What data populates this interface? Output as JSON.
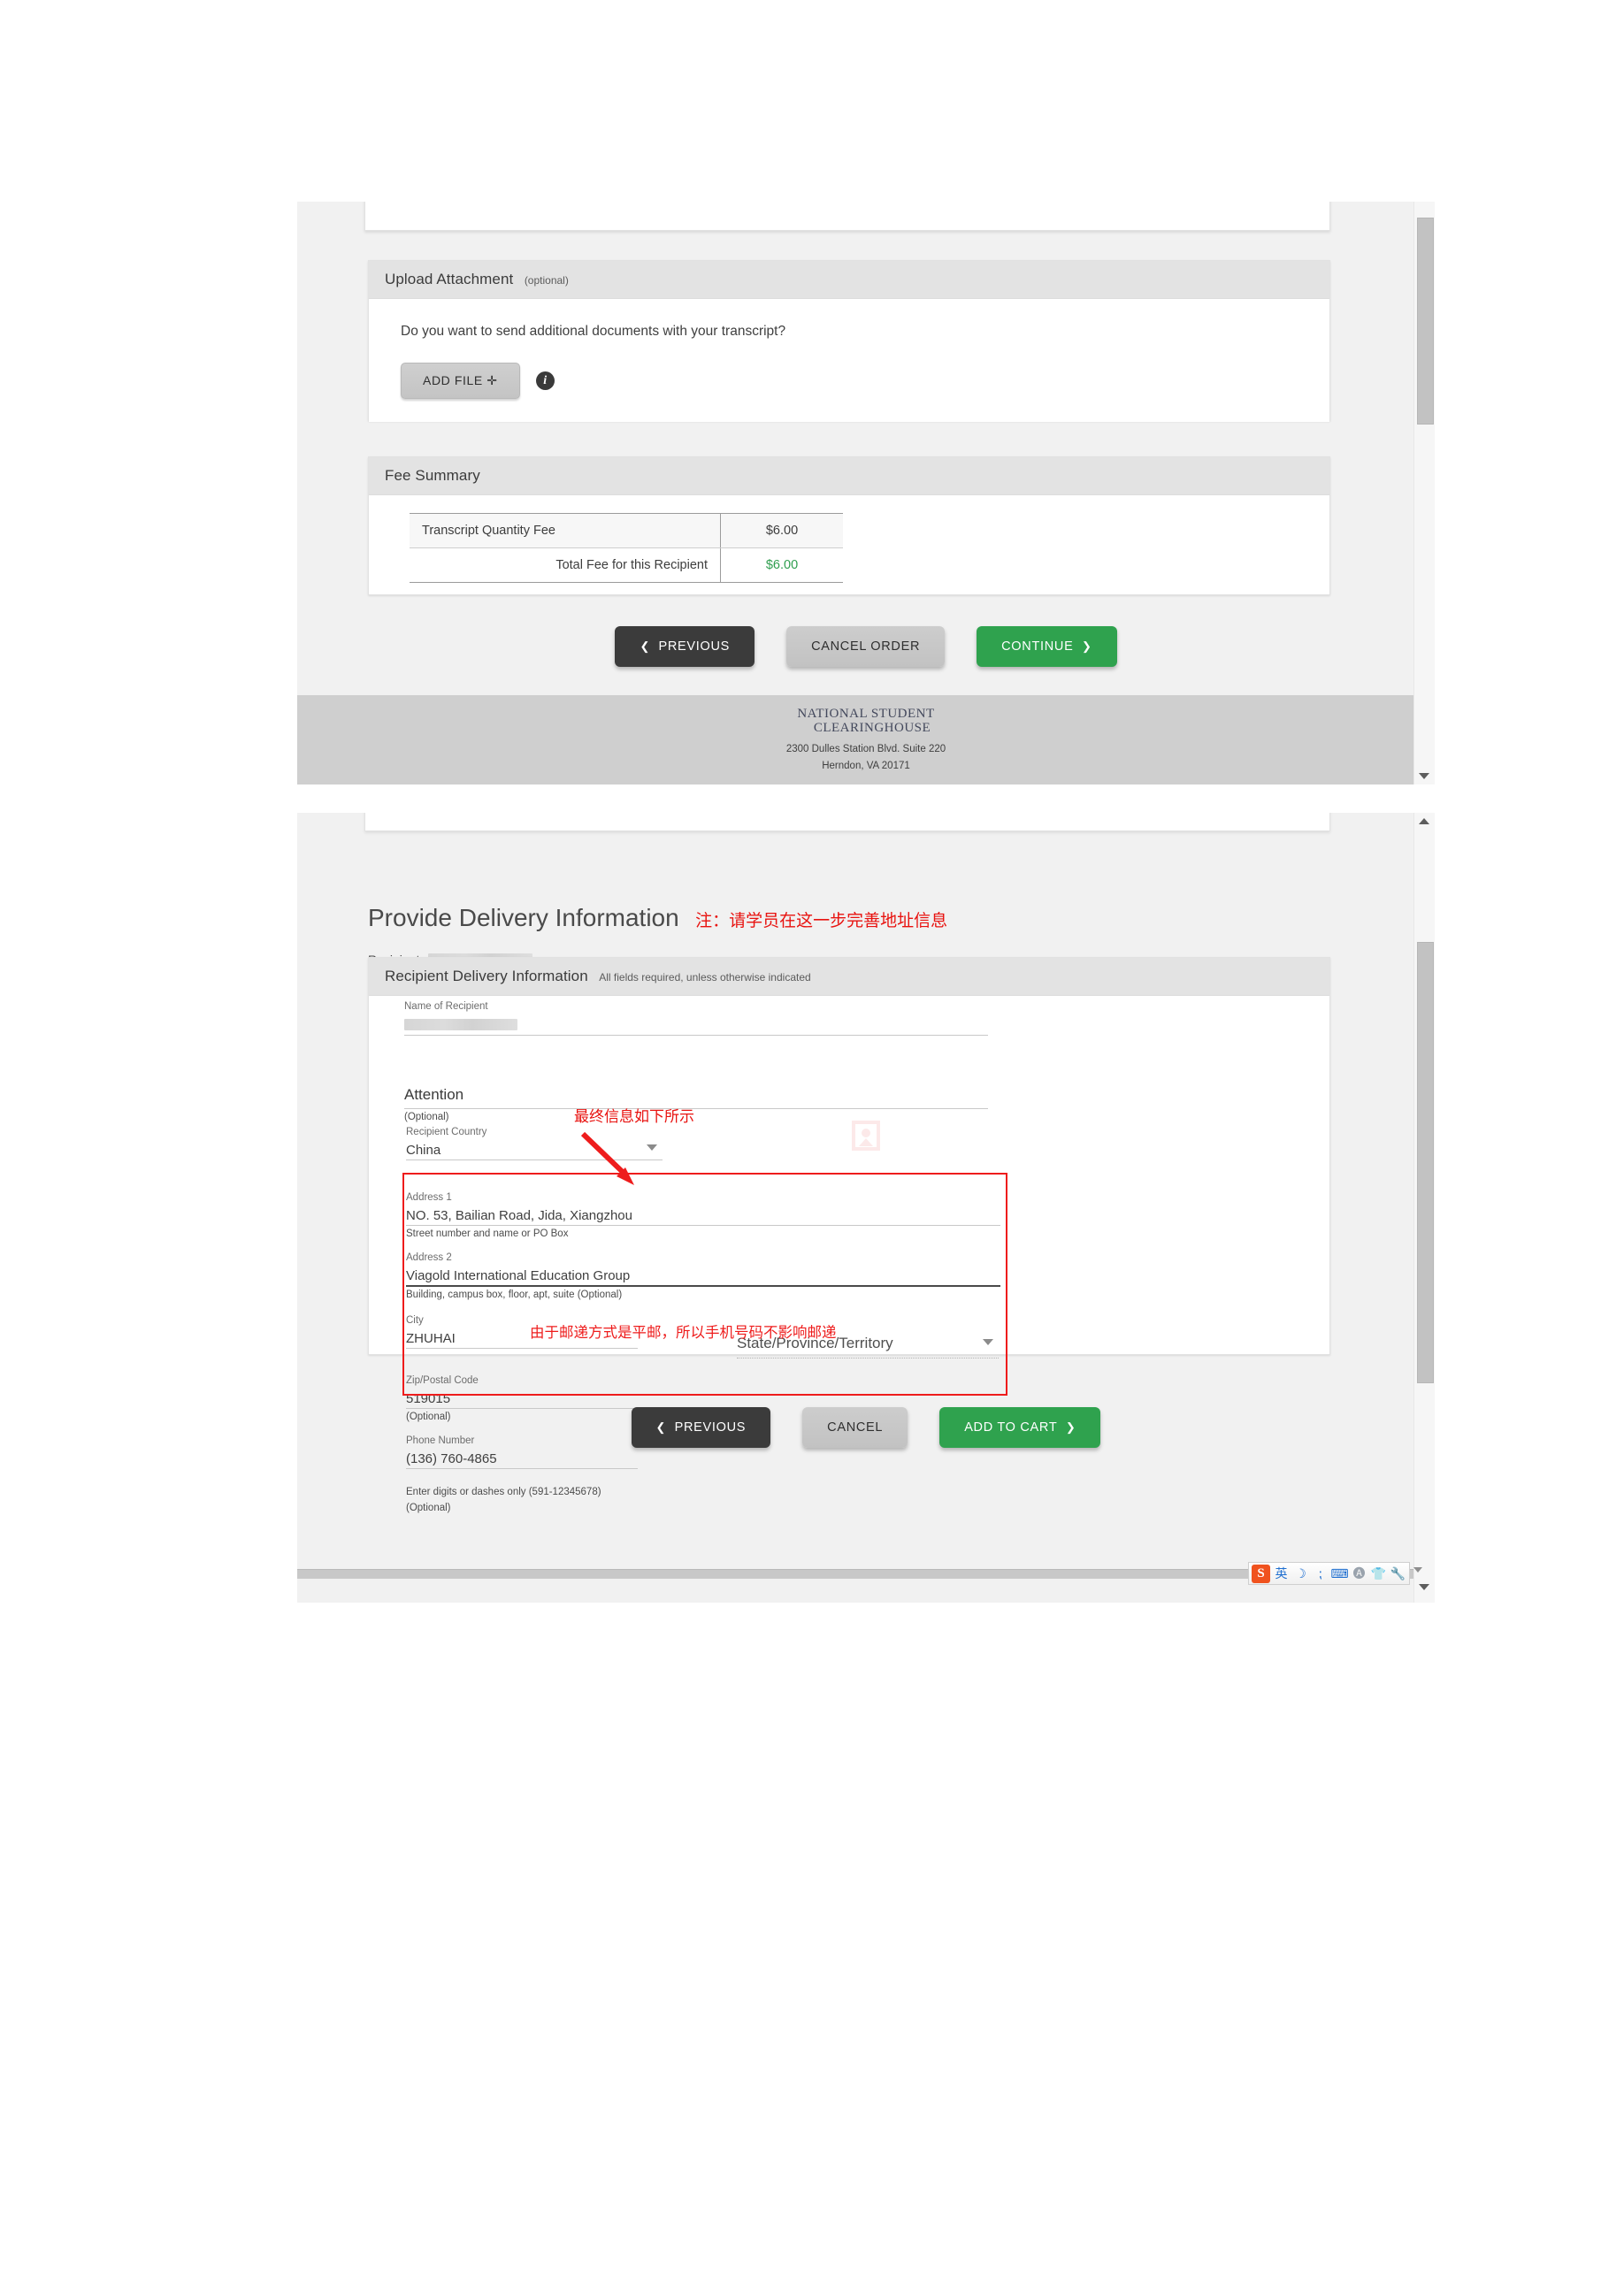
{
  "panel1": {
    "upload": {
      "title": "Upload Attachment",
      "optional": "(optional)",
      "question": "Do you want to send additional documents with your transcript?",
      "add_file_label": "ADD FILE  ✛",
      "info_icon": "info-icon"
    },
    "fee": {
      "title": "Fee Summary",
      "rows": [
        {
          "label": "Transcript Quantity Fee",
          "value": "$6.00"
        },
        {
          "label": "Total Fee for this Recipient",
          "value": "$6.00"
        }
      ]
    },
    "actions": {
      "previous": "PREVIOUS",
      "cancel_order": "CANCEL ORDER",
      "continue": "CONTINUE"
    },
    "footer": {
      "logo_line1": "NATIONAL STUDENT",
      "logo_line2": "CLEARINGHOUSE",
      "address1": "2300 Dulles Station Blvd. Suite 220",
      "address2": "Herndon, VA 20171"
    }
  },
  "panel2": {
    "page_title": "Provide Delivery Information",
    "annotation_title": "注：请学员在这一步完善地址信息",
    "recipient_label": "Recipient:",
    "card": {
      "title": "Recipient Delivery Information",
      "subtitle": "All fields required, unless otherwise indicated"
    },
    "annotation_arrow_text": "最终信息如下所示",
    "annotation_phone": "由于邮递方式是平邮，所以手机号码不影响邮递",
    "fields": {
      "name_of_recipient": {
        "label": "Name of Recipient",
        "value": ""
      },
      "attention": {
        "label": "Attention",
        "value": "",
        "hint": "(Optional)"
      },
      "recipient_country": {
        "label": "Recipient Country",
        "value": "China"
      },
      "address1": {
        "label": "Address 1",
        "value": "NO. 53, Bailian Road, Jida, Xiangzhou",
        "hint": "Street number and name or PO Box"
      },
      "address2": {
        "label": "Address 2",
        "value": "Viagold International Education Group",
        "hint": "Building, campus box, floor, apt, suite (Optional)"
      },
      "city": {
        "label": "City",
        "value": "ZHUHAI"
      },
      "state": {
        "label": "",
        "value": "State/Province/Territory"
      },
      "zip": {
        "label": "Zip/Postal Code",
        "value": "519015",
        "hint": "(Optional)"
      },
      "phone": {
        "label": "Phone Number",
        "value": "(136) 760-4865",
        "hint": "Enter digits or dashes only (591-12345678)",
        "hint2": "(Optional)"
      }
    },
    "actions": {
      "previous": "PREVIOUS",
      "cancel": "CANCEL",
      "add_to_cart": "ADD TO CART"
    }
  },
  "ime": {
    "logo": "S",
    "icons": [
      "英",
      "☽",
      "⁏",
      "⌨",
      "🅐",
      "👕",
      "🔧"
    ]
  },
  "colors": {
    "accent_green": "#2fa24e",
    "annotation_red": "#e8120f",
    "dark_button": "#3b3b3b"
  }
}
